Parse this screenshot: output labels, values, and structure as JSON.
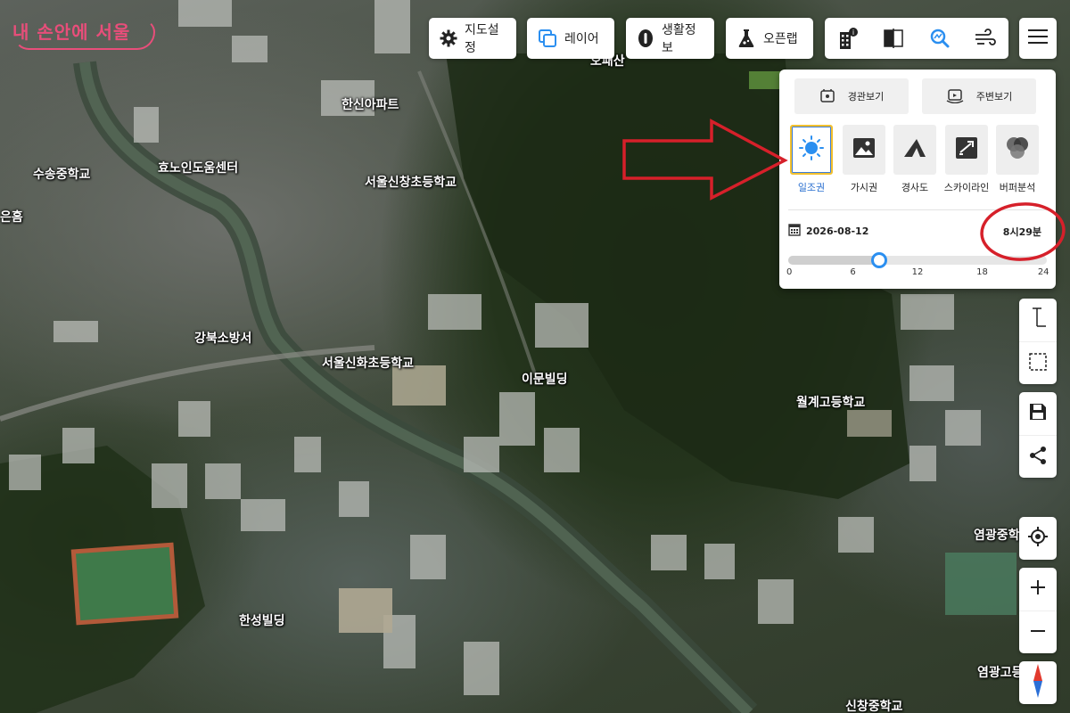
{
  "app": {
    "logo_text": "내 손안에 서울"
  },
  "toolbar": {
    "map_settings_label": "지도설정",
    "layers_label": "레이어",
    "life_info_label": "생활정보",
    "open_lab_label": "오픈랩"
  },
  "panel": {
    "landscape_view_label": "경관보기",
    "surrounding_view_label": "주변보기",
    "tools": [
      {
        "label": "일조권",
        "icon": "sun-icon",
        "active": true
      },
      {
        "label": "가시권",
        "icon": "image-icon",
        "active": false
      },
      {
        "label": "경사도",
        "icon": "slope-icon",
        "active": false
      },
      {
        "label": "스카이라인",
        "icon": "skyline-icon",
        "active": false
      },
      {
        "label": "버퍼분석",
        "icon": "buffer-icon",
        "active": false
      }
    ],
    "date": "2026-08-12",
    "time_display": "8시29분",
    "time_slider": {
      "min": 0,
      "max": 24,
      "value": 8.48
    },
    "ticks": [
      "0",
      "6",
      "12",
      "18",
      "24"
    ]
  },
  "map": {
    "places": [
      "한신아파트",
      "수송중학교",
      "효노인도움센터",
      "서울신창초등학교",
      "은홈",
      "강북소방서",
      "서울신화초등학교",
      "이문빌딩",
      "월계고등학교",
      "염광중학",
      "한성빌딩",
      "염광고등",
      "신창중학교",
      "오패산"
    ]
  },
  "colors": {
    "accent_blue": "#2b8ff0",
    "active_border": "#f2c02e",
    "annotation_red": "#d6202a",
    "logo_pink": "#e84e7a"
  }
}
